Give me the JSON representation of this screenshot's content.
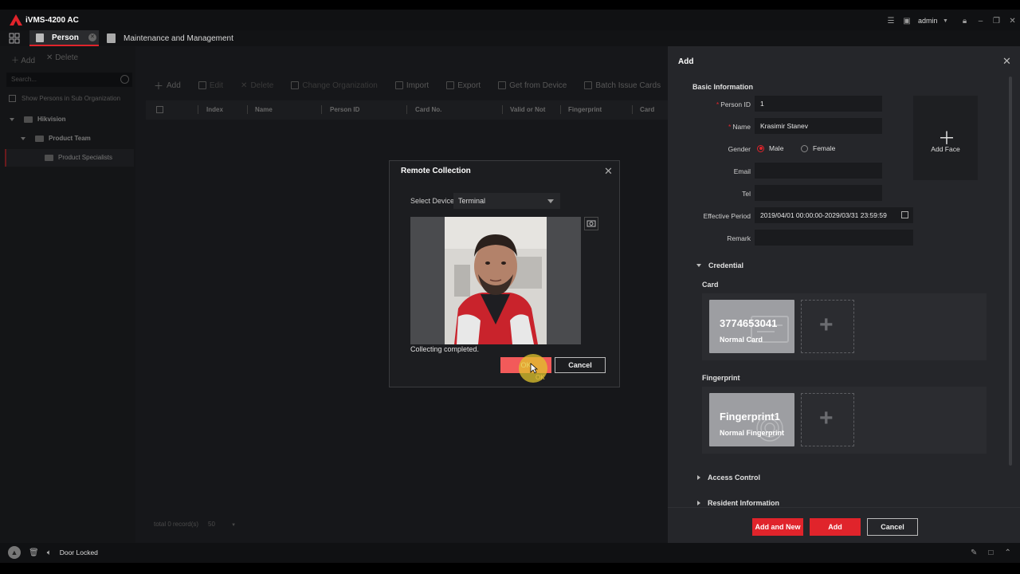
{
  "app": {
    "title": "iVMS-4200 AC",
    "user": "admin"
  },
  "tabs": [
    {
      "label": "Person"
    },
    {
      "label": "Maintenance and Management"
    }
  ],
  "left_panel": {
    "add_label": "Add",
    "delete_label": "Delete",
    "search_placeholder": "Search...",
    "show_sub_label": "Show Persons in Sub Organization",
    "tree": [
      {
        "label": "Hikvision"
      },
      {
        "label": "Product Team"
      },
      {
        "label": "Product Specialists"
      }
    ]
  },
  "center": {
    "toolbar": [
      "Add",
      "Edit",
      "Delete",
      "Change Organization",
      "Import",
      "Export",
      "Get from Device",
      "Batch Issue Cards"
    ],
    "columns": [
      "Index",
      "Name",
      "Person ID",
      "Card No.",
      "Valid or Not",
      "Fingerprint",
      "Card"
    ],
    "footer_total": "total 0 record(s)",
    "footer_page_size": "50"
  },
  "modal": {
    "title": "Remote Collection",
    "select_label": "Select Device",
    "select_value": "Terminal",
    "status": "Collecting completed.",
    "ok_label": "OK",
    "cancel_label": "Cancel",
    "cursor_tooltip": "OK"
  },
  "add_panel": {
    "title": "Add",
    "basic_info_title": "Basic Information",
    "fields": {
      "person_id_label": "Person ID",
      "person_id_value": "1",
      "name_label": "Name",
      "name_value": "Krasimir Stanev",
      "gender_label": "Gender",
      "gender_male": "Male",
      "gender_female": "Female",
      "gender_selected": "Male",
      "email_label": "Email",
      "email_value": "",
      "tel_label": "Tel",
      "tel_value": "",
      "effective_label": "Effective Period",
      "effective_value": "2019/04/01 00:00:00-2029/03/31 23:59:59",
      "remark_label": "Remark",
      "remark_value": ""
    },
    "add_face_label": "Add Face",
    "credential_title": "Credential",
    "card_title": "Card",
    "card": {
      "number": "3774653041",
      "type": "Normal Card"
    },
    "fingerprint_title": "Fingerprint",
    "fingerprint": {
      "name": "Fingerprint1",
      "type": "Normal Fingerprint"
    },
    "access_control_title": "Access Control",
    "resident_info_title": "Resident Information",
    "buttons": {
      "add_and_new": "Add and New",
      "add": "Add",
      "cancel": "Cancel"
    }
  },
  "status_bar": {
    "text": "Door Locked"
  },
  "colors": {
    "accent": "#e0242b",
    "ok_button": "#f25a5a",
    "panel": "#25262a"
  }
}
